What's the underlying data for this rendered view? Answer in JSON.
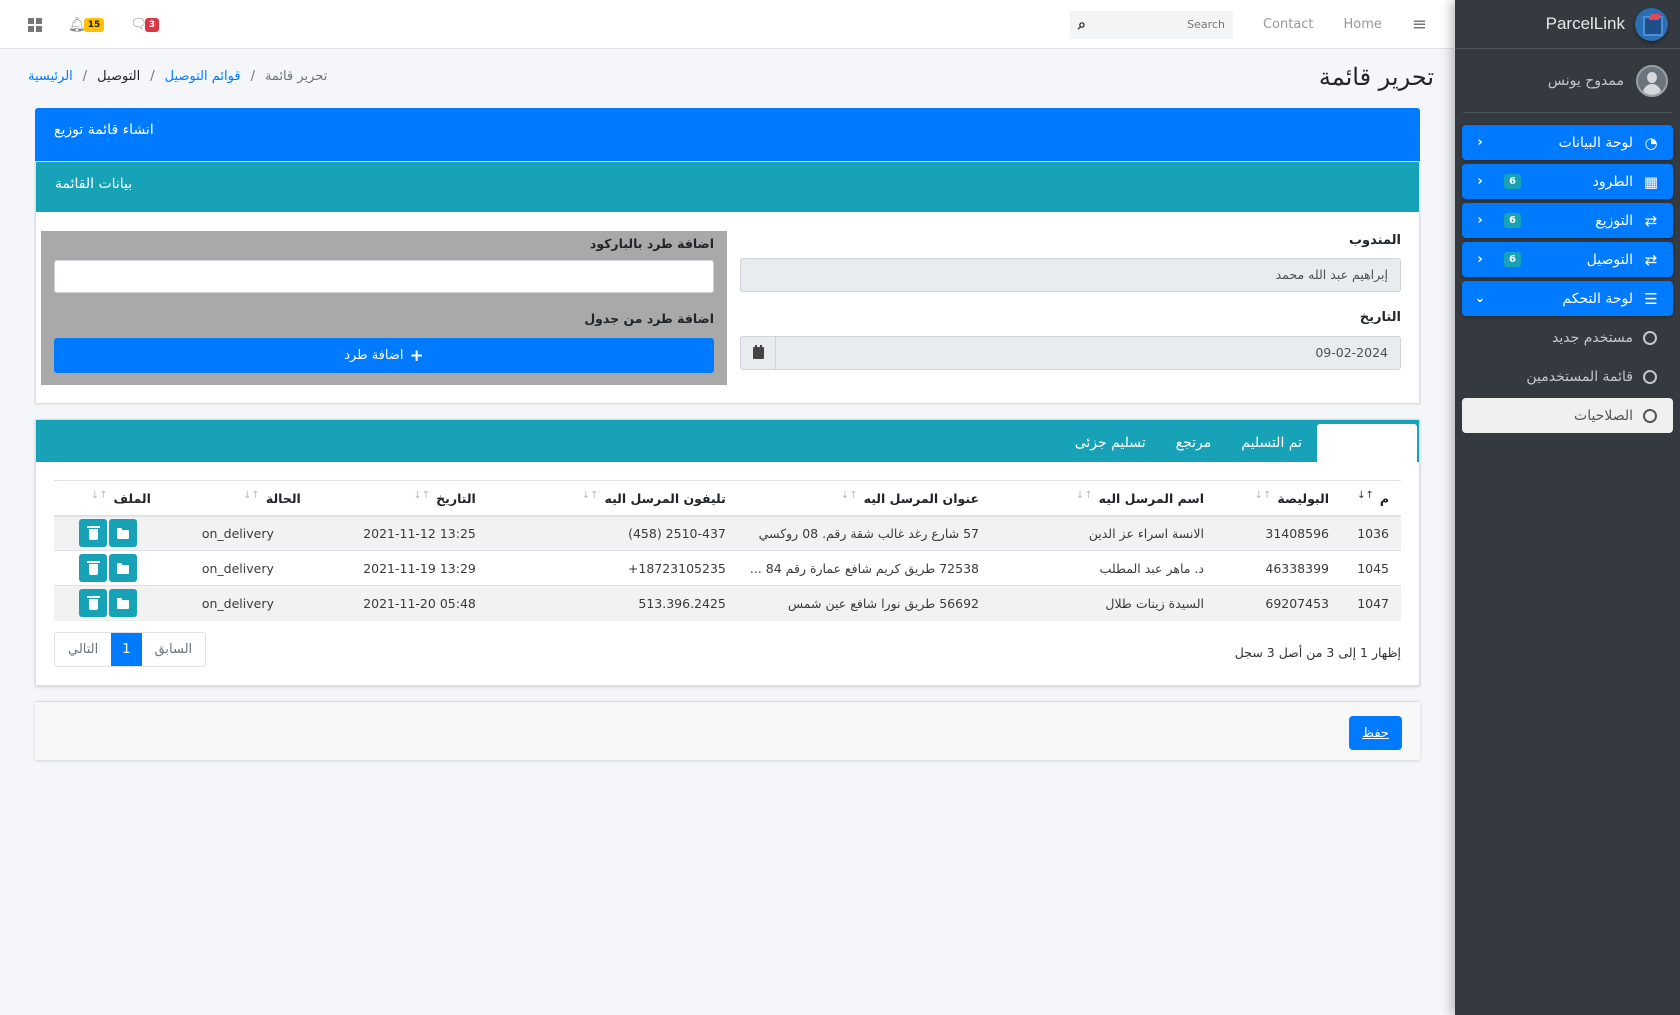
{
  "brand": {
    "name": "ParcelLink",
    "logo_icon": "parcel-box-icon"
  },
  "user": {
    "name": "ممدوح يونس",
    "avatar_icon": "user-avatar-icon"
  },
  "sidebar": {
    "items": [
      {
        "label": "لوحة البيانات",
        "icon": "dashboard-gauge-icon",
        "badge": null,
        "chevron": "‹"
      },
      {
        "label": "الطرود",
        "icon": "boxes-icon",
        "badge": "6",
        "chevron": "‹"
      },
      {
        "label": "التوزيع",
        "icon": "retweet-icon",
        "badge": "6",
        "chevron": "‹"
      },
      {
        "label": "التوصيل",
        "icon": "retweet-icon",
        "badge": "6",
        "chevron": "‹"
      },
      {
        "label": "لوحة التحكم",
        "icon": "server-icon",
        "badge": null,
        "chevron": "⌄",
        "expanded": true
      }
    ],
    "subitems": [
      {
        "label": "مستخدم جديد",
        "active": false
      },
      {
        "label": "قائمة المستخدمين",
        "active": false
      },
      {
        "label": "الصلاحيات",
        "active": true
      }
    ]
  },
  "topbar": {
    "notifications_count": "15",
    "messages_count": "3",
    "search_placeholder": "Search",
    "links": [
      "Contact",
      "Home"
    ]
  },
  "page": {
    "title": "تحرير قائمة",
    "breadcrumb": [
      {
        "label": "الرئيسية",
        "type": "link"
      },
      {
        "label": "التوصيل",
        "type": "plain"
      },
      {
        "label": "قوائم التوصيل",
        "type": "link"
      },
      {
        "label": "تحرير قائمة",
        "type": "active"
      }
    ],
    "breadcrumb_sep": "/"
  },
  "form": {
    "card_title": "انشاء قائمة توزيع",
    "section_title": "بيانات القائمة",
    "delegate_label": "المندوب",
    "delegate_value": "إبراهيم عبد الله محمد",
    "date_label": "التاريخ",
    "date_value": "09-02-2024",
    "barcode_label": "اضافة طرد بالباركود",
    "barcode_value": "",
    "table_add_label": "اضافة طرد من جدول",
    "add_parcel_button": "اضافة طرد",
    "add_parcel_icon": "+"
  },
  "tabs": [
    {
      "label": "",
      "active": true
    },
    {
      "label": "تم التسليم",
      "active": false
    },
    {
      "label": "مرتجع",
      "active": false
    },
    {
      "label": "تسليم جزئى",
      "active": false
    }
  ],
  "table": {
    "sort_glyph": "↑↓",
    "columns": [
      "م",
      "البوليصة",
      "اسم المرسل اليه",
      "عنوان المرسل اليه",
      "تليفون المرسل اليه",
      "التاريخ",
      "الحالة",
      "الملف"
    ],
    "rows": [
      {
        "id": "1036",
        "policy": "31408596",
        "name": "الانسة اسراء عز الدين",
        "address": "57 شارع رغد غالب شقة رقم. 08 روكسي",
        "phone": "(458) 2510-437",
        "date": "13:25 2021-11-12",
        "status": "on_delivery"
      },
      {
        "id": "1045",
        "policy": "46338399",
        "name": "د. ماهر عبد المطلب",
        "address": "72538 طريق كريم شافع عمارة رقم 84 ...",
        "phone": "+18723105235",
        "date": "13:29 2021-11-19",
        "status": "on_delivery"
      },
      {
        "id": "1047",
        "policy": "69207453",
        "name": "السيدة زينات طلال",
        "address": "56692 طريق نورا شافع عين شمس",
        "phone": "513.396.2425",
        "date": "05:48 2021-11-20",
        "status": "on_delivery"
      }
    ],
    "info": "إظهار 1 إلى 3 من أصل 3 سجل",
    "pagination": {
      "prev": "السابق",
      "current": "1",
      "next": "التالي"
    }
  },
  "footer": {
    "save_button": "حفظ"
  },
  "colors": {
    "primary": "#007bff",
    "info": "#17a2b8",
    "sidebar": "#343a40",
    "warning": "#ffc107",
    "danger": "#dc3545"
  }
}
